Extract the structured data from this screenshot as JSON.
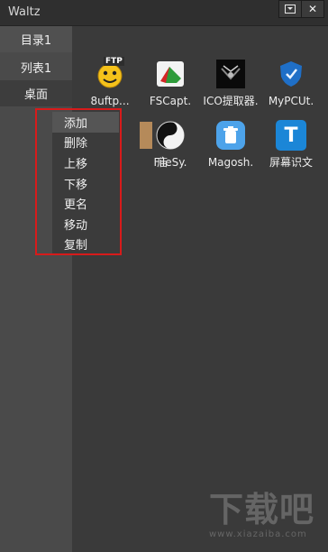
{
  "window": {
    "title": "Waltz",
    "buttons": [
      "dropdown-icon",
      "close-icon"
    ]
  },
  "sidebar": {
    "items": [
      {
        "label": "目录1",
        "state": "top"
      },
      {
        "label": "列表1",
        "state": "normal"
      },
      {
        "label": "桌面",
        "state": "selected"
      }
    ]
  },
  "apps": [
    {
      "label": "8uftp...",
      "icon": "ftp-smiley-icon",
      "badge": "FTP"
    },
    {
      "label": "FSCapt.",
      "icon": "fscapture-icon"
    },
    {
      "label": "ICO提取器.",
      "icon": "ico-extractor-icon"
    },
    {
      "label": "MyPCUt.",
      "icon": "shield-icon"
    },
    {
      "label": "庙",
      "icon": "partial-hidden-icon"
    },
    {
      "label": "FileSy.",
      "icon": "yin-yang-icon"
    },
    {
      "label": "Magosh.",
      "icon": "trash-can-icon"
    },
    {
      "label": "屏幕识文",
      "icon": "text-t-icon",
      "glyph": "T"
    }
  ],
  "context_menu": {
    "items": [
      "添加",
      "删除",
      "上移",
      "下移",
      "更名",
      "移动",
      "复制"
    ],
    "hovered": "添加",
    "highlight_color": "#d71b1b"
  },
  "watermark": {
    "brand": "下载吧",
    "domain": "www.xiazaiba.com"
  }
}
